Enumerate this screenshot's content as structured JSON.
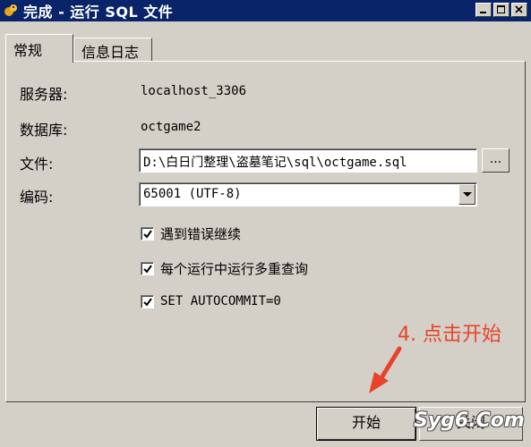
{
  "window": {
    "title": "完成 - 运行 SQL 文件",
    "icon": "squirrel-app-icon"
  },
  "tabs": [
    {
      "label": "常规",
      "active": true
    },
    {
      "label": "信息日志",
      "active": false
    }
  ],
  "form": {
    "server_label": "服务器:",
    "server_value": "localhost_3306",
    "database_label": "数据库:",
    "database_value": "octgame2",
    "file_label": "文件:",
    "file_value": "D:\\白日门整理\\盗墓笔记\\sql\\octgame.sql",
    "browse_label": "...",
    "encoding_label": "编码:",
    "encoding_value": "65001 (UTF-8)"
  },
  "options": [
    {
      "label": "遇到错误继续",
      "checked": true
    },
    {
      "label": "每个运行中运行多重查询",
      "checked": true
    },
    {
      "label": "SET AUTOCOMMIT=0",
      "checked": true
    }
  ],
  "annotation": {
    "text": "4. 点击开始",
    "color": "#e8432a"
  },
  "buttons": {
    "start_label": "开始",
    "close_label": "关闭"
  },
  "watermark": "Syg6.Com"
}
